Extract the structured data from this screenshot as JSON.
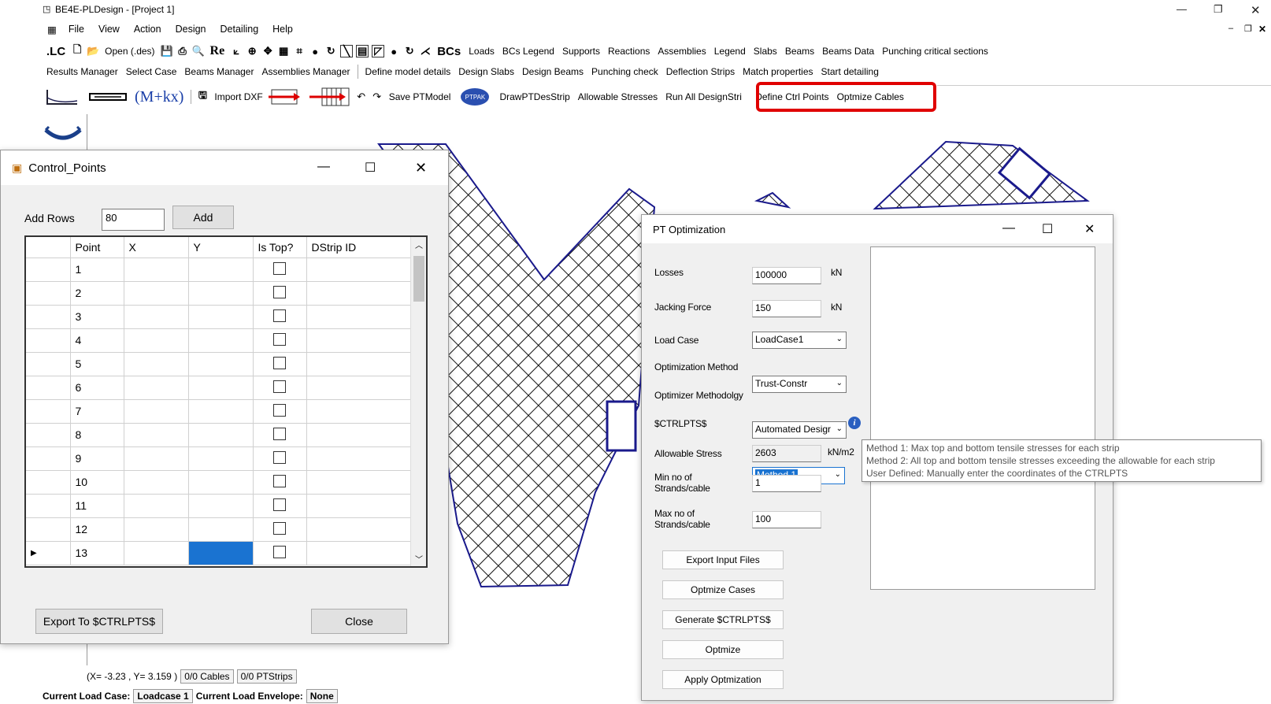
{
  "app": {
    "title": "BE4E-PLDesign - [Project 1]"
  },
  "menu": [
    "File",
    "View",
    "Action",
    "Design",
    "Detailing",
    "Help"
  ],
  "toolbar1": {
    "lc": ".LC",
    "open": "Open (.des)",
    "re": "Re",
    "bcs": "BCs",
    "items": [
      "Loads",
      "BCs Legend",
      "Supports",
      "Reactions",
      "Assemblies",
      "Legend",
      "Slabs",
      "Beams",
      "Beams Data",
      "Punching critical sections"
    ]
  },
  "toolbar2": {
    "items": [
      "Results Manager",
      "Select Case",
      "Beams Manager",
      "Assemblies Manager",
      "Define model details",
      "Design Slabs",
      "Design Beams",
      "Punching check",
      "Deflection Strips",
      "Match properties",
      "Start detailing"
    ]
  },
  "toolbar3": {
    "mkx": "(M+kx)",
    "import_dxf": "Import DXF",
    "save_ptmodel": "Save PTModel",
    "ptpak": "PTPAK",
    "draw_ptdesstrip": "DrawPTDesStrip",
    "allowable_stresses": "Allowable Stresses",
    "run_all": "Run All DesignStrip",
    "define_ctrl_points": "Define Ctrl Points",
    "optimize_cables": "Optmize Cables"
  },
  "status": {
    "coords": "(X= -3.23 , Y= 3.159 )",
    "cables": "0/0 Cables",
    "ptstrips": "0/0 PTStrips",
    "current_load_case_label": "Current Load Case:",
    "current_load_case": "Loadcase 1",
    "current_load_envelope_label": "Current Load Envelope:",
    "current_load_envelope": "None"
  },
  "control_points": {
    "title": "Control_Points",
    "add_rows_label": "Add Rows",
    "add_rows_value": "80",
    "add_button": "Add",
    "columns": [
      "Point",
      "X",
      "Y",
      "Is Top?",
      "DStrip ID"
    ],
    "rows": [
      "1",
      "2",
      "3",
      "4",
      "5",
      "6",
      "7",
      "8",
      "9",
      "10",
      "11",
      "12",
      "13"
    ],
    "export_button": "Export To $CTRLPTS$",
    "close_button": "Close"
  },
  "pt_optimization": {
    "title": "PT Optimization",
    "losses_label": "Losses",
    "losses_value": "100000",
    "losses_unit": "kN",
    "jacking_label": "Jacking Force",
    "jacking_value": "150",
    "jacking_unit": "kN",
    "load_case_label": "Load Case",
    "load_case_value": "LoadCase1",
    "method_label": "Optimization Method",
    "method_value": "Trust-Constr",
    "methodology_label": "Optimizer Methodolgy",
    "methodology_value": "Automated Desigr",
    "ctrlpts_label": "$CTRLPTS$",
    "ctrlpts_value": "Method 1",
    "allowable_label": "Allowable Stress",
    "allowable_value": "2603",
    "allowable_unit": "kN/m2",
    "min_strands_label_1": "Min no of",
    "min_strands_label_2": "Strands/cable",
    "min_strands_value": "1",
    "max_strands_label_1": "Max no of",
    "max_strands_label_2": "Strands/cable",
    "max_strands_value": "100",
    "buttons": [
      "Export Input Files",
      "Optmize Cases",
      "Generate $CTRLPTS$",
      "Optmize",
      "Apply Optmization"
    ],
    "tooltip": [
      "Method 1: Max top and bottom tensile stresses for each strip",
      "Method 2: All top and bottom tensile stresses exceeding the allowable for each strip",
      "User Defined: Manually enter the coordinates of the CTRLPTS"
    ]
  },
  "colors": {
    "highlight": "#e00000",
    "selected_cell": "#1a73d1",
    "slab_outline": "#1a1a8c"
  }
}
